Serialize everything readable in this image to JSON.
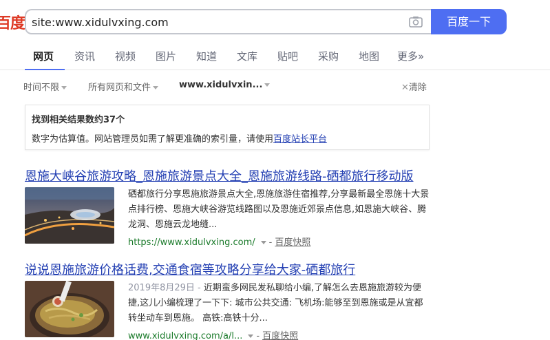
{
  "header": {
    "logo_text": "百度",
    "search_value": "site:www.xidulvxing.com",
    "search_button": "百度一下",
    "camera_icon": "camera-icon"
  },
  "nav": {
    "tabs": [
      {
        "label": "网页",
        "active": true
      },
      {
        "label": "资讯"
      },
      {
        "label": "视频"
      },
      {
        "label": "图片"
      },
      {
        "label": "知道"
      },
      {
        "label": "文库"
      },
      {
        "label": "贴吧"
      },
      {
        "label": "采购"
      },
      {
        "label": "地图"
      },
      {
        "label": "更多»"
      }
    ]
  },
  "filters": {
    "time": "时间不限",
    "filetype": "所有网页和文件",
    "site": "www.xidulvxin...",
    "clear": "清除"
  },
  "info": {
    "title": "找到相关结果数约37个",
    "text": "数字为估算值。网站管理员如需了解更准确的索引量，请使用",
    "link": "百度站长平台"
  },
  "results": [
    {
      "title": "恩施大峡谷旅游攻略_恩施旅游景点大全_恩施旅游线路-硒都旅行移动版",
      "date": "",
      "abstract": "硒都旅行分享恩施旅游景点大全,恩施旅游住宿推荐,分享最新最全恩施十大景点排行榜、恩施大峡谷游览线路图以及恩施近郊景点信息,如恩施大峡谷、腾龙洞、恩施云龙地缝...",
      "url": "https://www.xidulvxing.com/",
      "separator": "-",
      "snapshot": "百度快照"
    },
    {
      "title": "说说恩施旅游价格话费,交通食宿等攻略分享给大家-硒都旅行",
      "date": "2019年8月29日 - ",
      "abstract": "近期蛮多网民发私聊给小编,了解怎么去恩施旅游较为便捷,这儿小编梳理了一下下: 城市公共交通: 飞机场:能够至到恩施或是从宜都转坐动车到恩施。 高铁:高铁十分...",
      "url": "www.xidulvxing.com/a/l...",
      "separator": "-",
      "snapshot": "百度快照"
    }
  ]
}
